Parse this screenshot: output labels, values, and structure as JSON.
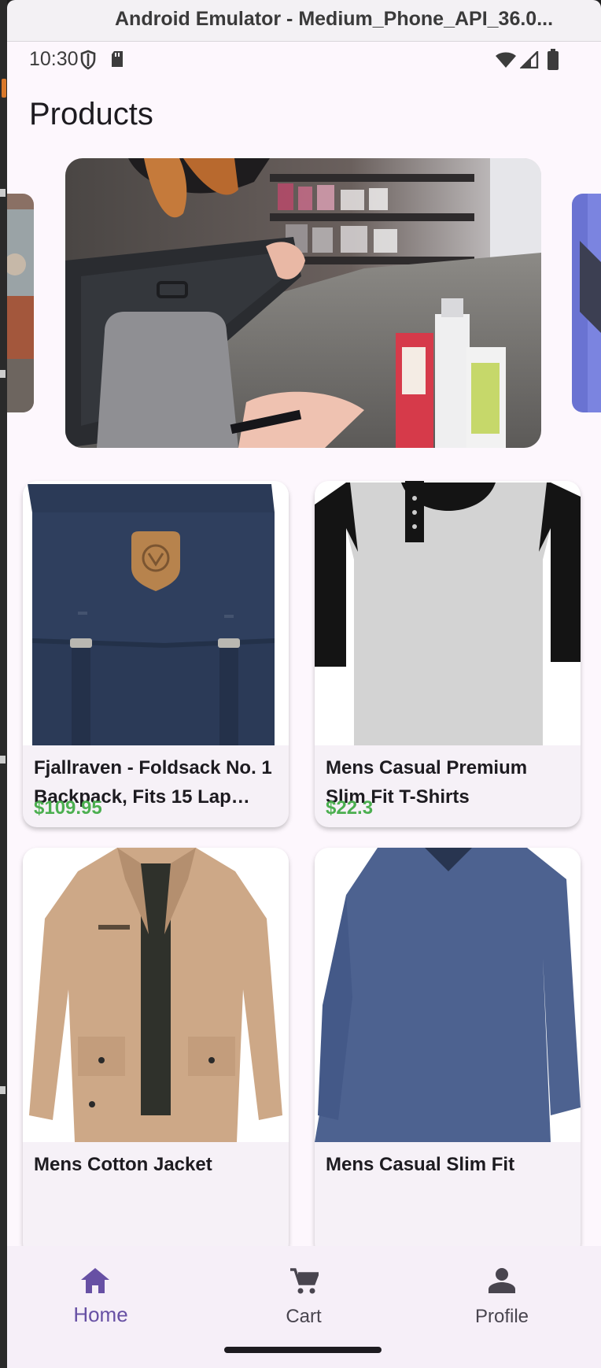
{
  "window": {
    "title": "Android Emulator - Medium_Phone_API_36.0..."
  },
  "status_bar": {
    "time": "10:30",
    "left_icons": [
      "shield-icon",
      "sd-card-icon"
    ],
    "right_icons": [
      "wifi-icon",
      "signal-icon",
      "battery-icon"
    ]
  },
  "header": {
    "title": "Products"
  },
  "carousel": {
    "slides": [
      "left-partial-slide",
      "checkout-counter-slide",
      "right-partial-slide"
    ]
  },
  "products": [
    {
      "title": "Fjallraven - Foldsack No. 1 Backpack, Fits 15 Lap…",
      "price": "$109.95",
      "image": "navy-backpack"
    },
    {
      "title": "Mens Casual Premium Slim Fit T-Shirts",
      "price": "$22.3",
      "image": "raglan-tshirt"
    },
    {
      "title": "Mens Cotton Jacket",
      "price": "",
      "image": "khaki-jacket"
    },
    {
      "title": "Mens Casual Slim Fit",
      "price": "",
      "image": "blue-longsleeve"
    }
  ],
  "bottom_nav": {
    "items": [
      {
        "label": "Home",
        "icon": "home-icon",
        "active": true
      },
      {
        "label": "Cart",
        "icon": "cart-icon",
        "active": false
      },
      {
        "label": "Profile",
        "icon": "person-icon",
        "active": false
      }
    ]
  },
  "colors": {
    "background": "#fdf7fd",
    "card": "#f6f1f7",
    "price": "#4caf50",
    "accent": "#6750a4"
  }
}
